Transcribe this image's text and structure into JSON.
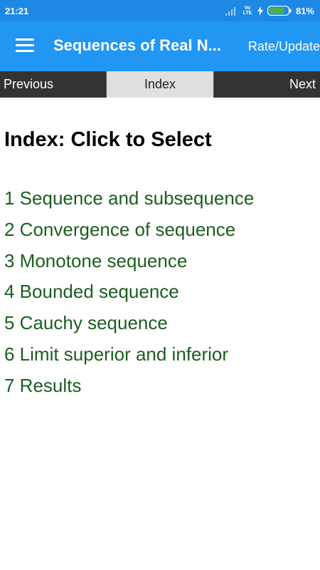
{
  "status_bar": {
    "time": "21:21",
    "network": "Vo LTE",
    "battery_percent": "81%",
    "battery_level": 0.81,
    "icons": [
      "signal-icon",
      "volte-icon",
      "charging-icon",
      "battery-icon"
    ]
  },
  "app_bar": {
    "title": "Sequences of Real N...",
    "rate_update": "Rate/Update",
    "menu_icon": "hamburger-menu-icon"
  },
  "nav": {
    "previous": "Previous",
    "index": "Index",
    "next": "Next"
  },
  "content": {
    "heading": "Index: Click to Select",
    "items": [
      "1 Sequence and subsequence",
      "2 Convergence of sequence",
      "3 Monotone sequence",
      "4 Bounded sequence",
      "5 Cauchy sequence",
      "6 Limit superior and inferior",
      "7 Results"
    ]
  },
  "colors": {
    "status_bar": "#1e88e5",
    "app_bar": "#2196f3",
    "nav_dark": "#333333",
    "nav_active": "#e0e0e0",
    "link_green": "#1b5e20"
  }
}
